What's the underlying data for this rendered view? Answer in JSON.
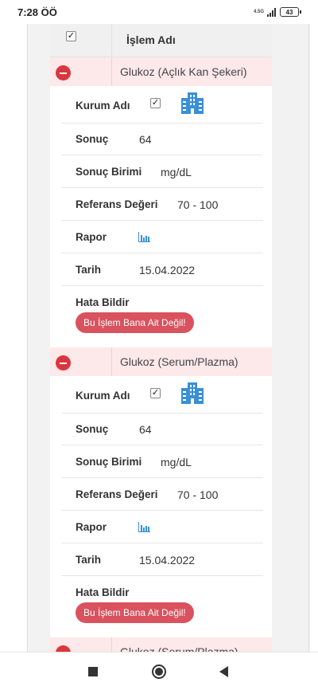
{
  "status_bar": {
    "time": "7:28 ÖÖ",
    "network": "4.5G",
    "battery": "43"
  },
  "table": {
    "header": {
      "title": "İşlem Adı"
    },
    "records": [
      {
        "name": "Glukoz (Açlık Kan Şekeri)",
        "institution_label": "Kurum Adı",
        "result_label": "Sonuç",
        "result_value": "64",
        "unit_label": "Sonuç Birimi",
        "unit_value": "mg/dL",
        "reference_label": "Referans Değeri",
        "reference_value": "70 - 100",
        "report_label": "Rapor",
        "date_label": "Tarih",
        "date_value": "15.04.2022",
        "error_label": "Hata Bildir",
        "error_button": "Bu İşlem Bana Ait Değil!"
      },
      {
        "name": "Glukoz (Serum/Plazma)",
        "institution_label": "Kurum Adı",
        "result_label": "Sonuç",
        "result_value": "64",
        "unit_label": "Sonuç Birimi",
        "unit_value": "mg/dL",
        "reference_label": "Referans Değeri",
        "reference_value": "70 - 100",
        "report_label": "Rapor",
        "date_label": "Tarih",
        "date_value": "15.04.2022",
        "error_label": "Hata Bildir",
        "error_button": "Bu İşlem Bana Ait Değil!"
      },
      {
        "name": "Glukoz (Serum/Plazma)"
      }
    ]
  },
  "icons": {
    "institution": "building-icon",
    "report": "bar-chart-icon",
    "remove": "minus-circle-icon"
  },
  "colors": {
    "accent_red": "#d9363e",
    "button_red": "#d9525e",
    "row_pink": "#fde8ea",
    "icon_blue": "#3a8fd6"
  }
}
